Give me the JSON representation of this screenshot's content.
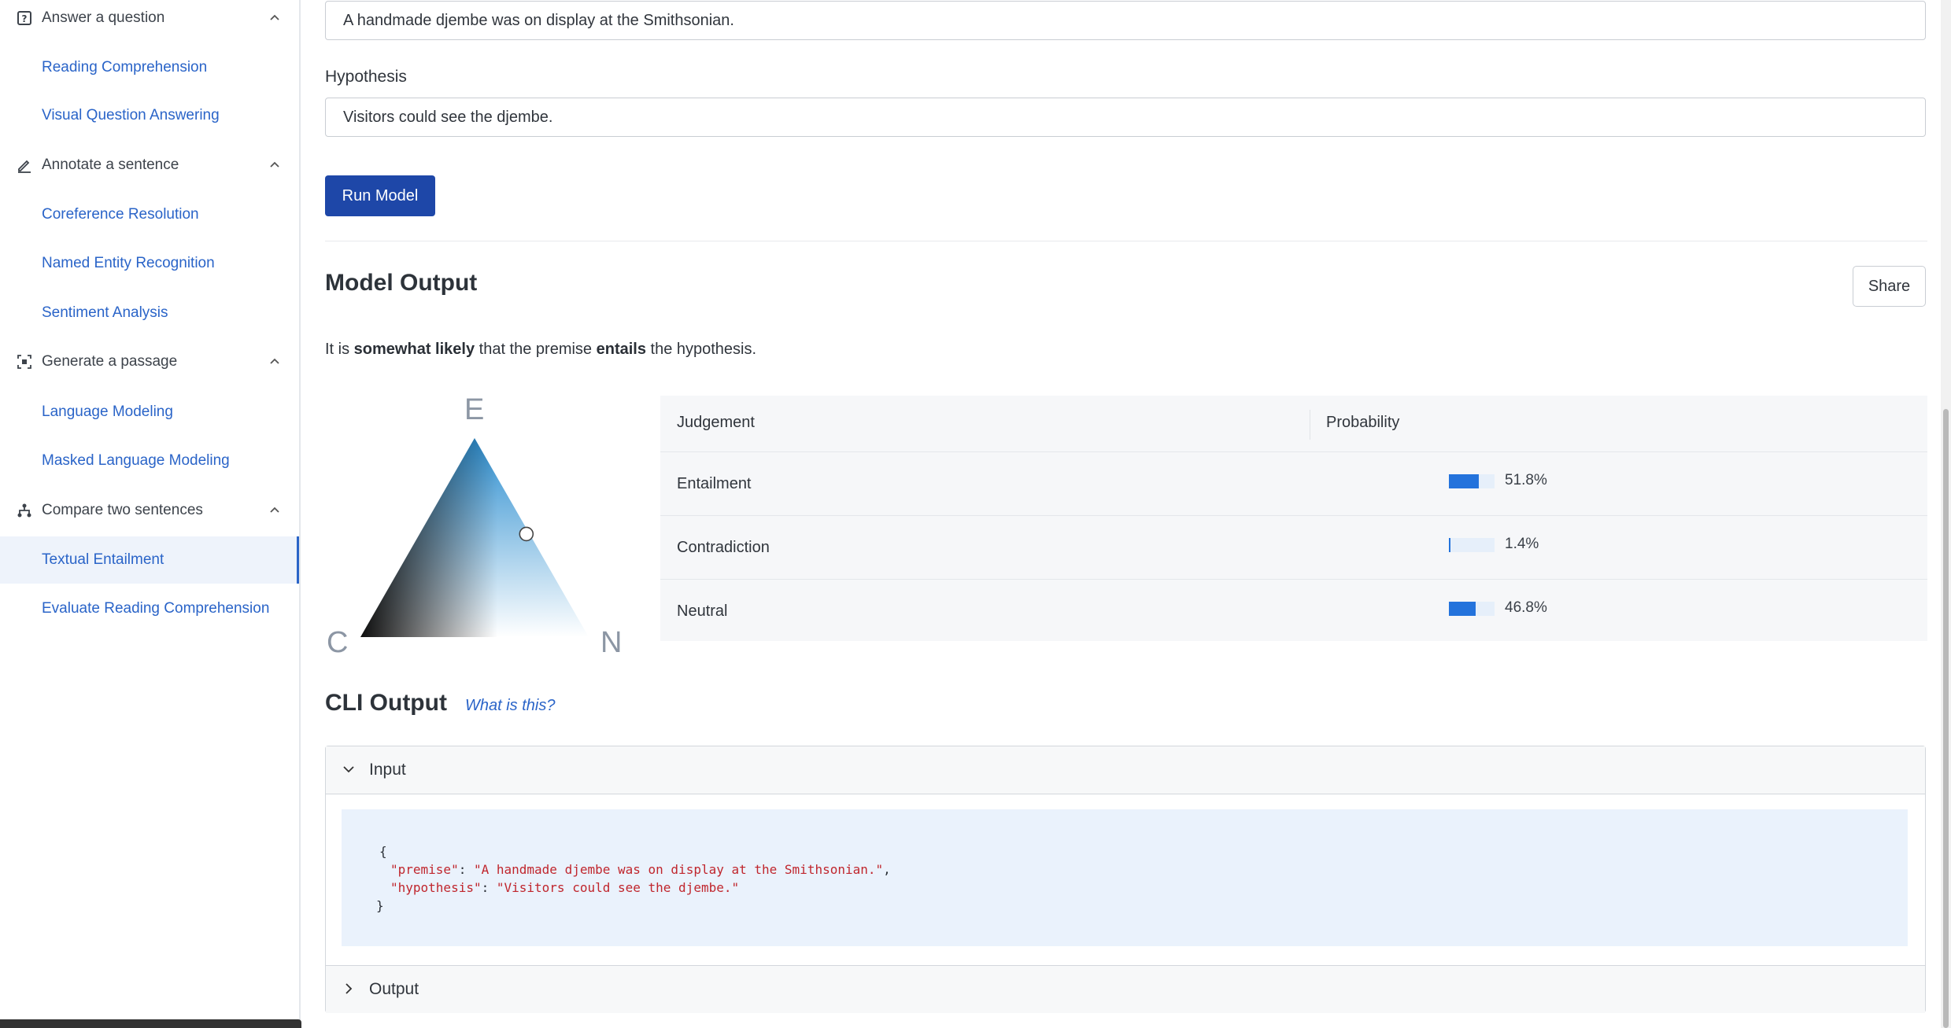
{
  "sidebar": {
    "groups": [
      {
        "label": "Answer a question",
        "icon": "question-box-icon",
        "items": [
          "Reading Comprehension",
          "Visual Question Answering"
        ]
      },
      {
        "label": "Annotate a sentence",
        "icon": "pencil-icon",
        "items": [
          "Coreference Resolution",
          "Named Entity Recognition",
          "Sentiment Analysis"
        ]
      },
      {
        "label": "Generate a passage",
        "icon": "frame-expand-icon",
        "items": [
          "Language Modeling",
          "Masked Language Modeling"
        ]
      },
      {
        "label": "Compare two sentences",
        "icon": "hierarchy-icon",
        "items": [
          "Textual Entailment",
          "Evaluate Reading Comprehension"
        ]
      }
    ],
    "active_item": "Textual Entailment"
  },
  "form": {
    "premise_value": "A handmade djembe was on display at the Smithsonian.",
    "hypothesis_label": "Hypothesis",
    "hypothesis_value": "Visitors could see the djembe.",
    "run_button": "Run Model"
  },
  "output": {
    "title": "Model Output",
    "share_button": "Share",
    "summary": {
      "prefix": "It is ",
      "likelihood": "somewhat likely",
      "middle": " that the premise ",
      "relation": "entails",
      "suffix": " the hypothesis."
    },
    "triangle": {
      "top": "E",
      "left": "C",
      "right": "N"
    },
    "table": {
      "headers": [
        "Judgement",
        "Probability"
      ],
      "rows": [
        {
          "label": "Entailment",
          "value": 51.8,
          "display": "51.8%"
        },
        {
          "label": "Contradiction",
          "value": 1.4,
          "display": "1.4%"
        },
        {
          "label": "Neutral",
          "value": 46.8,
          "display": "46.8%"
        }
      ]
    },
    "colors": {
      "bar": "#2473dc",
      "bar_bg": "#e6effa"
    }
  },
  "cli": {
    "title": "CLI Output",
    "help_link": "What is this?",
    "input_label": "Input",
    "output_label": "Output",
    "code": {
      "open": "{",
      "premise_key": "\"premise\"",
      "premise_val": "\"A handmade djembe was on display at the Smithsonian.\"",
      "hypothesis_key": "\"hypothesis\"",
      "hypothesis_val": "\"Visitors could see the djembe.\"",
      "close": "}"
    }
  }
}
